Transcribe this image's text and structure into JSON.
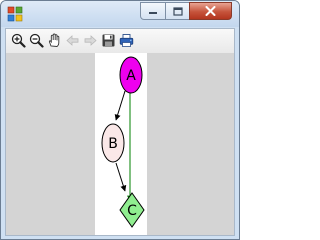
{
  "window": {
    "title": "",
    "icon": "app-windows-icon",
    "controls": [
      "minimize-icon",
      "maximize-icon",
      "close-icon"
    ]
  },
  "toolbar": {
    "buttons": [
      {
        "name": "zoom-in",
        "icon": "zoom-in-icon",
        "enabled": true
      },
      {
        "name": "zoom-out",
        "icon": "zoom-out-icon",
        "enabled": true
      },
      {
        "name": "pan",
        "icon": "hand-icon",
        "enabled": true
      },
      {
        "name": "back",
        "icon": "arrow-left-icon",
        "enabled": false
      },
      {
        "name": "forward",
        "icon": "arrow-right-icon",
        "enabled": false
      },
      {
        "name": "save",
        "icon": "floppy-disk-icon",
        "enabled": true
      },
      {
        "name": "print",
        "icon": "printer-icon",
        "enabled": true
      }
    ]
  },
  "graph": {
    "nodes": [
      {
        "id": "A",
        "label": "A",
        "shape": "ellipse",
        "fill": "#ee00ee"
      },
      {
        "id": "B",
        "label": "B",
        "shape": "ellipse",
        "fill": "#fae8e8"
      },
      {
        "id": "C",
        "label": "C",
        "shape": "diamond",
        "fill": "#90ee90"
      }
    ],
    "edges": [
      {
        "from": "A",
        "to": "B",
        "color": "#000000"
      },
      {
        "from": "B",
        "to": "C",
        "color": "#000000"
      },
      {
        "from": "A",
        "to": "C",
        "color": "#008000"
      }
    ]
  },
  "colors": {
    "canvas_background": "#d4d4d4",
    "page_background": "#ffffff",
    "close_button": "#c6543c"
  }
}
